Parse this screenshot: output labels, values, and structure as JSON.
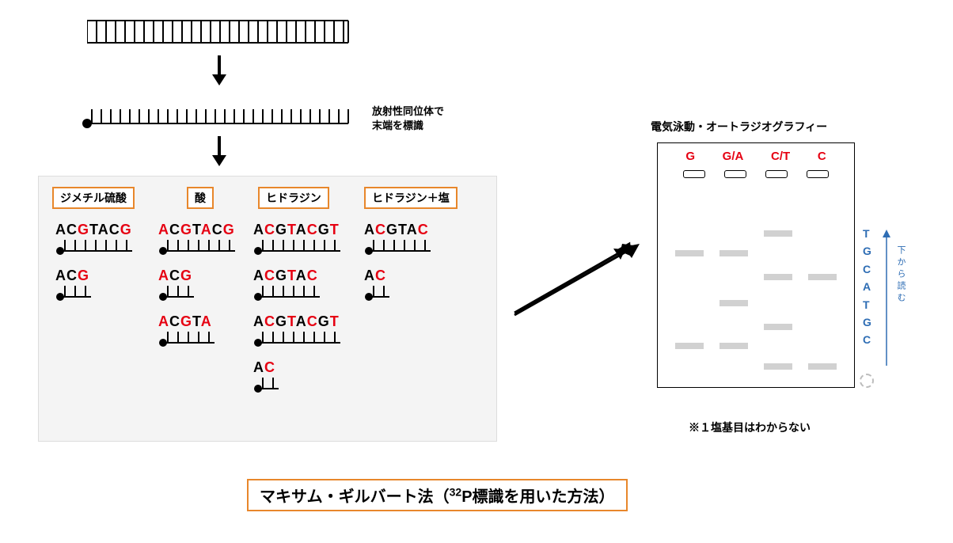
{
  "labels": {
    "radiolabel_line1": "放射性同位体で",
    "radiolabel_line2": "末端を標識",
    "gel_title": "電気泳動・オートラジオグラフィー",
    "footnote": "※１塩基目はわからない",
    "read_direction": "下から読む"
  },
  "reagents": {
    "r1": "ジメチル硫酸",
    "r2": "酸",
    "r3": "ヒドラジン",
    "r4": "ヒドラジン＋塩"
  },
  "fragments": {
    "col1": {
      "f1": [
        [
          "A",
          "k"
        ],
        [
          "C",
          "k"
        ],
        [
          "G",
          "r"
        ],
        [
          "T",
          "k"
        ],
        [
          "A",
          "k"
        ],
        [
          "C",
          "k"
        ],
        [
          "G",
          "r"
        ]
      ],
      "f2": [
        [
          "A",
          "k"
        ],
        [
          "C",
          "k"
        ],
        [
          "G",
          "r"
        ]
      ]
    },
    "col2": {
      "f1": [
        [
          "A",
          "r"
        ],
        [
          "C",
          "k"
        ],
        [
          "G",
          "r"
        ],
        [
          "T",
          "k"
        ],
        [
          "A",
          "r"
        ],
        [
          "C",
          "k"
        ],
        [
          "G",
          "r"
        ]
      ],
      "f2": [
        [
          "A",
          "r"
        ],
        [
          "C",
          "k"
        ],
        [
          "G",
          "r"
        ]
      ],
      "f3": [
        [
          "A",
          "r"
        ],
        [
          "C",
          "k"
        ],
        [
          "G",
          "r"
        ],
        [
          "T",
          "k"
        ],
        [
          "A",
          "r"
        ]
      ]
    },
    "col3": {
      "f1": [
        [
          "A",
          "k"
        ],
        [
          "C",
          "r"
        ],
        [
          "G",
          "k"
        ],
        [
          "T",
          "r"
        ],
        [
          "A",
          "k"
        ],
        [
          "C",
          "r"
        ],
        [
          "G",
          "k"
        ],
        [
          "T",
          "r"
        ]
      ],
      "f2": [
        [
          "A",
          "k"
        ],
        [
          "C",
          "r"
        ],
        [
          "G",
          "k"
        ],
        [
          "T",
          "r"
        ],
        [
          "A",
          "k"
        ],
        [
          "C",
          "r"
        ]
      ],
      "f3": [
        [
          "A",
          "k"
        ],
        [
          "C",
          "r"
        ],
        [
          "G",
          "k"
        ],
        [
          "T",
          "r"
        ],
        [
          "A",
          "k"
        ],
        [
          "C",
          "r"
        ],
        [
          "G",
          "k"
        ],
        [
          "T",
          "r"
        ]
      ],
      "f4": [
        [
          "A",
          "k"
        ],
        [
          "C",
          "r"
        ]
      ]
    },
    "col4": {
      "f1": [
        [
          "A",
          "k"
        ],
        [
          "C",
          "r"
        ],
        [
          "G",
          "k"
        ],
        [
          "T",
          "k"
        ],
        [
          "A",
          "k"
        ],
        [
          "C",
          "r"
        ]
      ],
      "f2": [
        [
          "A",
          "k"
        ],
        [
          "C",
          "r"
        ]
      ]
    }
  },
  "gel": {
    "lanes": [
      "G",
      "G/A",
      "C/T",
      "C"
    ],
    "read_sequence": [
      "T",
      "G",
      "C",
      "A",
      "T",
      "G",
      "C"
    ]
  },
  "title_pre": "マキサム・ギルバート法（",
  "title_sup": "32",
  "title_post": "P標識を用いた方法）"
}
